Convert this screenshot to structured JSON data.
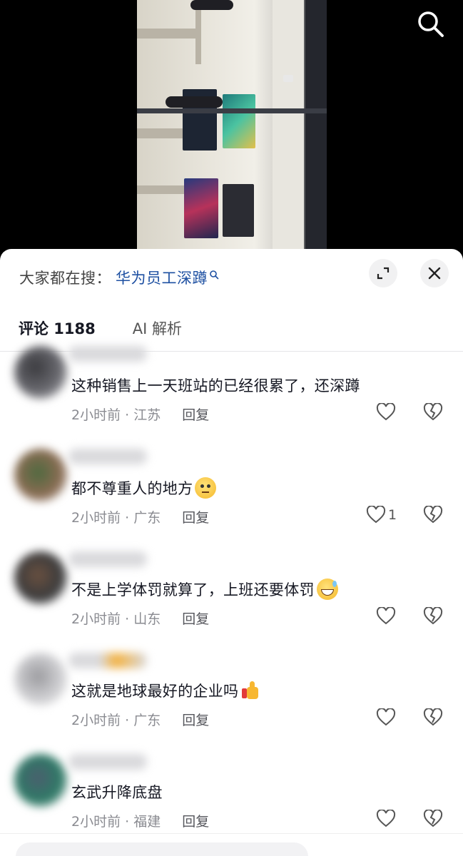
{
  "search": {
    "prefix": "大家都在搜：",
    "term": "华为员工深蹲"
  },
  "tabs": [
    {
      "label": "评论 1188"
    },
    {
      "label": "AI 解析"
    }
  ],
  "comments": [
    {
      "text": "这种销售上一天班站的已经很累了，还深蹲",
      "time": "2小时前 · 江苏",
      "reply": "回复",
      "likes": "",
      "emoji": ""
    },
    {
      "text": "都不尊重人的地方",
      "time": "2小时前 · 广东",
      "reply": "回复",
      "likes": "1",
      "emoji": "thinking-face-emoji"
    },
    {
      "text": "不是上学体罚就算了，上班还要体罚",
      "time": "2小时前 · 山东",
      "reply": "回复",
      "likes": "",
      "emoji": "grinning-sweat-emoji"
    },
    {
      "text": "这就是地球最好的企业吗",
      "time": "2小时前 · 广东",
      "reply": "回复",
      "likes": "",
      "emoji": "thumbs-up-emoji"
    },
    {
      "text": "玄武升降底盘",
      "time": "2小时前 · 福建",
      "reply": "回复",
      "likes": "",
      "emoji": ""
    }
  ],
  "colors": {
    "link": "#1e50a2",
    "text": "#161823",
    "meta": "#8a8b91"
  }
}
